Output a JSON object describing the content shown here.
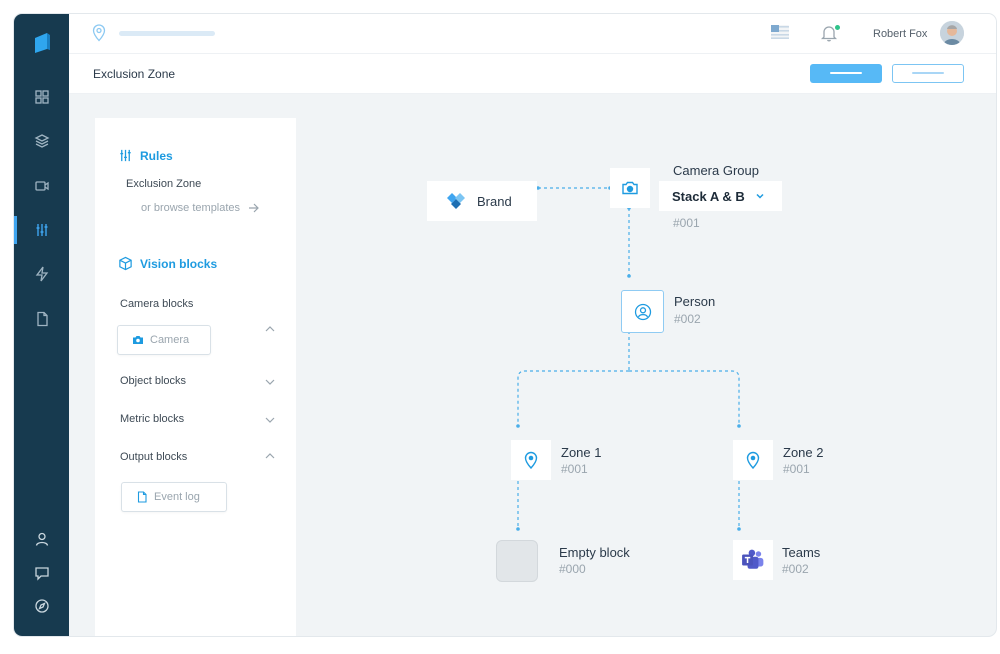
{
  "colors": {
    "rail": "#173a4f",
    "accent": "#1e9be0",
    "primary_button": "#57b9f6",
    "teams": "#5059c9"
  },
  "rail": {
    "items": [
      {
        "name": "dashboard",
        "icon": "grid-icon"
      },
      {
        "name": "layers",
        "icon": "layers-icon"
      },
      {
        "name": "video",
        "icon": "video-camera-icon"
      },
      {
        "name": "rules",
        "icon": "sliders-icon",
        "active": true
      },
      {
        "name": "actions",
        "icon": "lightning-icon"
      },
      {
        "name": "documents",
        "icon": "document-icon"
      }
    ],
    "bottom": [
      {
        "name": "profile",
        "icon": "user-icon"
      },
      {
        "name": "chat",
        "icon": "chat-icon"
      },
      {
        "name": "explore",
        "icon": "compass-icon"
      }
    ]
  },
  "header": {
    "username": "Robert Fox"
  },
  "page": {
    "title": "Exclusion Zone"
  },
  "panel": {
    "rules": {
      "heading": "Rules",
      "item": "Exclusion Zone",
      "browse": "or browse templates"
    },
    "vision": {
      "heading": "Vision blocks",
      "groups": [
        {
          "label": "Camera blocks",
          "expanded": true,
          "chip": "Camera"
        },
        {
          "label": "Object blocks",
          "expanded": false
        },
        {
          "label": "Metric blocks",
          "expanded": false
        },
        {
          "label": "Output blocks",
          "expanded": true,
          "chip": "Event log"
        }
      ]
    }
  },
  "flow": {
    "brand": {
      "label": "Brand"
    },
    "camera_group": {
      "label": "Camera Group",
      "selected": "Stack A & B",
      "id": "#001"
    },
    "person": {
      "label": "Person",
      "id": "#002"
    },
    "zone1": {
      "label": "Zone 1",
      "id": "#001"
    },
    "zone2": {
      "label": "Zone 2",
      "id": "#001"
    },
    "empty": {
      "label": "Empty block",
      "id": "#000"
    },
    "teams": {
      "label": "Teams",
      "id": "#002"
    }
  }
}
